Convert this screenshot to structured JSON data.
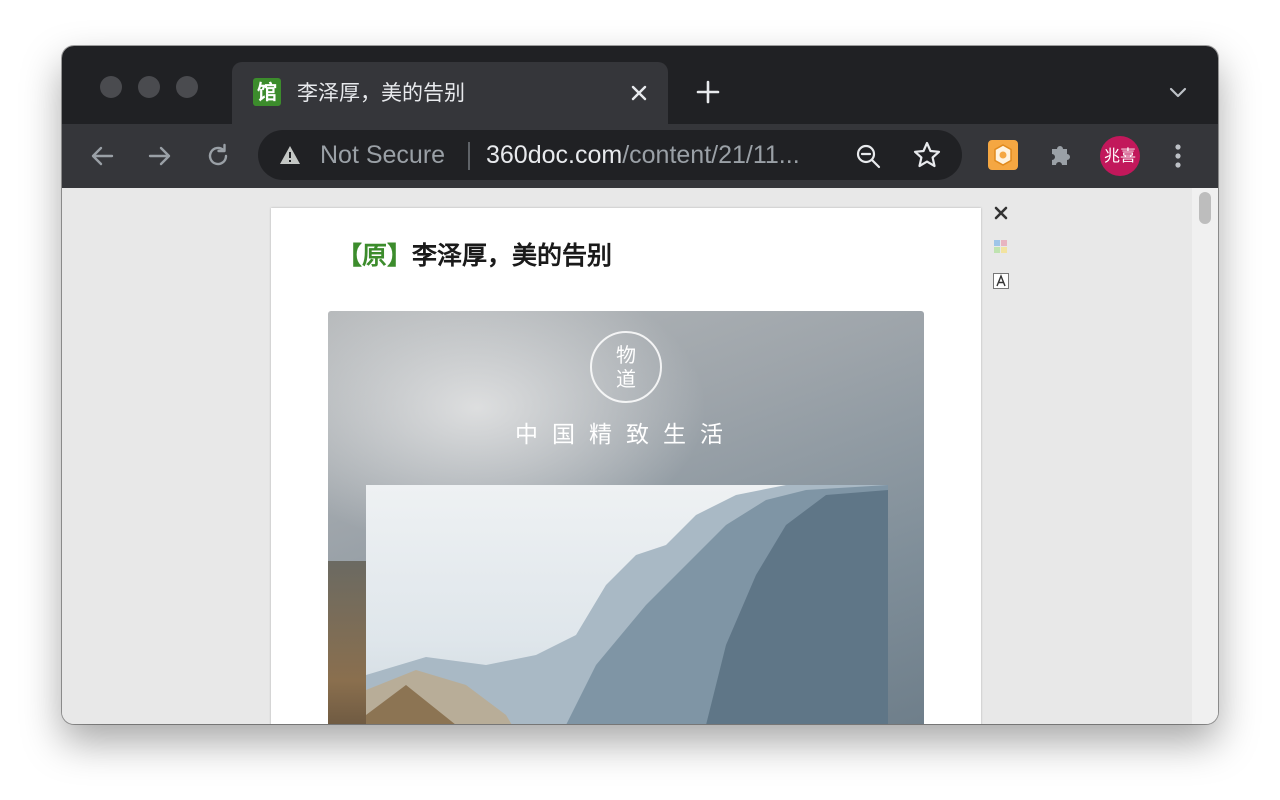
{
  "window": {
    "tab": {
      "favicon_text": "馆",
      "title": "李泽厚，美的告别"
    }
  },
  "toolbar": {
    "security_label": "Not Secure",
    "url_host": "360doc.com",
    "url_path": "/content/21/11...",
    "profile_initials": "兆喜"
  },
  "page": {
    "heading_tag": "【原】",
    "heading_title": "李泽厚，美的告别",
    "hero": {
      "seal_text_1": "物",
      "seal_text_2": "道",
      "slogan": "中国精致生活"
    }
  },
  "colors": {
    "chrome_dark": "#202124",
    "chrome_tab": "#35363a",
    "brand_green": "#3c8c2c",
    "avatar_bg": "#c2185b"
  }
}
